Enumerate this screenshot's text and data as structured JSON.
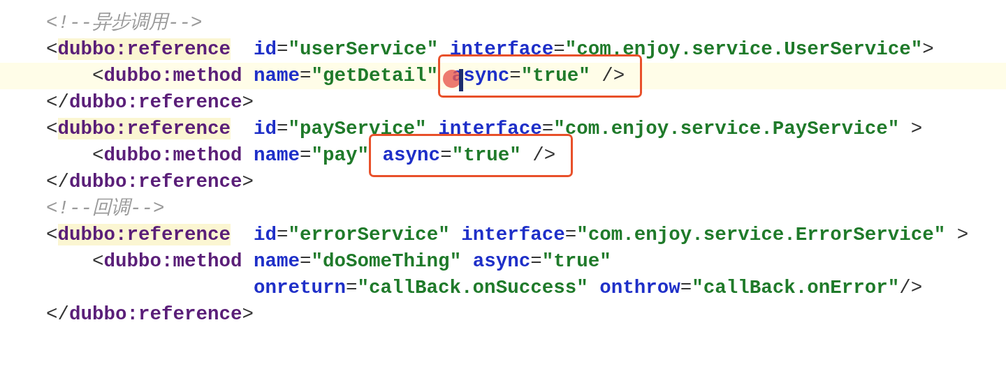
{
  "lines": [
    {
      "current": false,
      "segments": [
        {
          "kind": "plain",
          "tokens": [
            {
              "kind": "comment",
              "text": "<!--异步调用-->"
            }
          ]
        }
      ]
    },
    {
      "current": false,
      "segments": [
        {
          "kind": "plain",
          "tokens": [
            {
              "kind": "punct",
              "text": "<"
            },
            {
              "kind": "tag-match",
              "text": "dubbo:reference"
            },
            {
              "kind": "attr",
              "text": "  id"
            },
            {
              "kind": "punct",
              "text": "="
            },
            {
              "kind": "value",
              "text": "\"userService\""
            },
            {
              "kind": "attr",
              "text": " interface"
            },
            {
              "kind": "punct",
              "text": "="
            },
            {
              "kind": "value",
              "text": "\"com.enjoy.service.UserService\""
            },
            {
              "kind": "punct",
              "text": ">"
            }
          ]
        }
      ]
    },
    {
      "current": true,
      "segments": [
        {
          "kind": "plain",
          "tokens": [
            {
              "kind": "punct",
              "text": "    <"
            },
            {
              "kind": "tag",
              "text": "dubbo:method"
            },
            {
              "kind": "attr",
              "text": " name"
            },
            {
              "kind": "punct",
              "text": "="
            },
            {
              "kind": "value",
              "text": "\"getDetail\""
            }
          ]
        },
        {
          "kind": "boxed",
          "tokens": [
            {
              "kind": "attr",
              "text": " async"
            },
            {
              "kind": "punct",
              "text": "="
            },
            {
              "kind": "value",
              "text": "\"true\""
            },
            {
              "kind": "punct",
              "text": " />"
            }
          ]
        }
      ]
    },
    {
      "current": false,
      "segments": [
        {
          "kind": "plain",
          "tokens": [
            {
              "kind": "punct",
              "text": "</"
            },
            {
              "kind": "tag",
              "text": "dubbo:reference"
            },
            {
              "kind": "punct",
              "text": ">"
            }
          ]
        }
      ]
    },
    {
      "current": false,
      "segments": [
        {
          "kind": "plain",
          "tokens": [
            {
              "kind": "punct",
              "text": "<"
            },
            {
              "kind": "tag-match",
              "text": "dubbo:reference"
            },
            {
              "kind": "attr",
              "text": "  id"
            },
            {
              "kind": "punct",
              "text": "="
            },
            {
              "kind": "value",
              "text": "\"payService\""
            },
            {
              "kind": "attr",
              "text": " interface"
            },
            {
              "kind": "punct",
              "text": "="
            },
            {
              "kind": "value",
              "text": "\"com.enjoy.service.PayService\""
            },
            {
              "kind": "punct",
              "text": " >"
            }
          ]
        }
      ]
    },
    {
      "current": false,
      "segments": [
        {
          "kind": "plain",
          "tokens": [
            {
              "kind": "punct",
              "text": "    <"
            },
            {
              "kind": "tag",
              "text": "dubbo:method"
            },
            {
              "kind": "attr",
              "text": " name"
            },
            {
              "kind": "punct",
              "text": "="
            },
            {
              "kind": "value",
              "text": "\"pay\""
            }
          ]
        },
        {
          "kind": "boxed",
          "tokens": [
            {
              "kind": "attr",
              "text": " async"
            },
            {
              "kind": "punct",
              "text": "="
            },
            {
              "kind": "value",
              "text": "\"true\""
            },
            {
              "kind": "punct",
              "text": " />"
            }
          ]
        }
      ]
    },
    {
      "current": false,
      "segments": [
        {
          "kind": "plain",
          "tokens": [
            {
              "kind": "punct",
              "text": "</"
            },
            {
              "kind": "tag",
              "text": "dubbo:reference"
            },
            {
              "kind": "punct",
              "text": ">"
            }
          ]
        }
      ]
    },
    {
      "current": false,
      "segments": [
        {
          "kind": "plain",
          "tokens": [
            {
              "kind": "comment",
              "text": "<!--回调-->"
            }
          ]
        }
      ]
    },
    {
      "current": false,
      "segments": [
        {
          "kind": "plain",
          "tokens": [
            {
              "kind": "punct",
              "text": "<"
            },
            {
              "kind": "tag-match",
              "text": "dubbo:reference"
            },
            {
              "kind": "attr",
              "text": "  id"
            },
            {
              "kind": "punct",
              "text": "="
            },
            {
              "kind": "value",
              "text": "\"errorService\""
            },
            {
              "kind": "attr",
              "text": " interface"
            },
            {
              "kind": "punct",
              "text": "="
            },
            {
              "kind": "value",
              "text": "\"com.enjoy.service.ErrorService\""
            },
            {
              "kind": "punct",
              "text": " >"
            }
          ]
        }
      ]
    },
    {
      "current": false,
      "segments": [
        {
          "kind": "plain",
          "tokens": [
            {
              "kind": "punct",
              "text": "    <"
            },
            {
              "kind": "tag",
              "text": "dubbo:method"
            },
            {
              "kind": "attr",
              "text": " name"
            },
            {
              "kind": "punct",
              "text": "="
            },
            {
              "kind": "value",
              "text": "\"doSomeThing\""
            },
            {
              "kind": "attr",
              "text": " async"
            },
            {
              "kind": "punct",
              "text": "="
            },
            {
              "kind": "value",
              "text": "\"true\""
            }
          ]
        }
      ]
    },
    {
      "current": false,
      "segments": [
        {
          "kind": "plain",
          "tokens": [
            {
              "kind": "attr",
              "text": "                  onreturn"
            },
            {
              "kind": "punct",
              "text": "="
            },
            {
              "kind": "value",
              "text": "\"callBack.onSuccess\""
            },
            {
              "kind": "attr",
              "text": " onthrow"
            },
            {
              "kind": "punct",
              "text": "="
            },
            {
              "kind": "value",
              "text": "\"callBack.onError\""
            },
            {
              "kind": "punct",
              "text": "/>"
            }
          ]
        }
      ]
    },
    {
      "current": false,
      "segments": [
        {
          "kind": "plain",
          "tokens": [
            {
              "kind": "punct",
              "text": "</"
            },
            {
              "kind": "tag",
              "text": "dubbo:reference"
            },
            {
              "kind": "punct",
              "text": ">"
            }
          ]
        }
      ]
    }
  ]
}
